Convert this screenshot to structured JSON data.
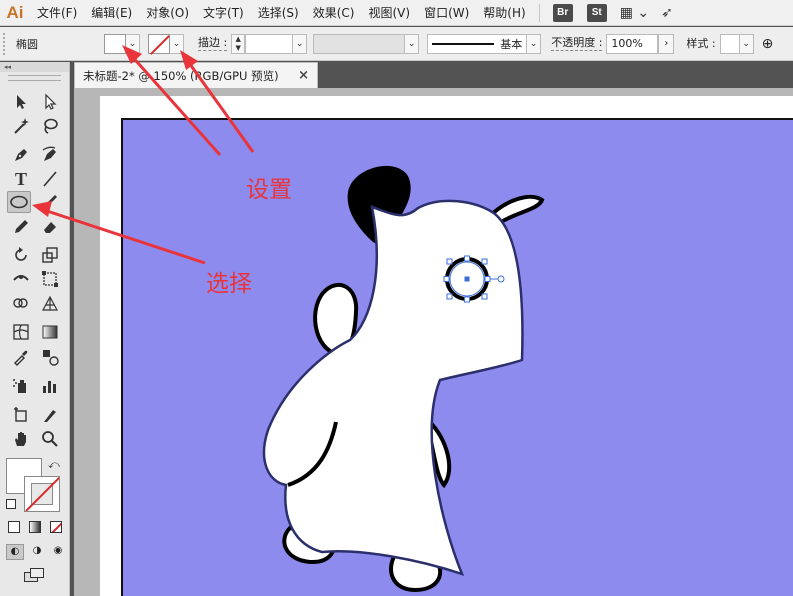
{
  "app": {
    "logo": "Ai"
  },
  "menu": [
    "文件(F)",
    "编辑(E)",
    "对象(O)",
    "文字(T)",
    "选择(S)",
    "效果(C)",
    "视图(V)",
    "窗口(W)",
    "帮助(H)"
  ],
  "bridge_badges": [
    "Br",
    "St"
  ],
  "control": {
    "tool_name": "椭圆",
    "stroke_label": "描边 :",
    "stroke_style": "基本",
    "opacity_label": "不透明度 :",
    "opacity_value": "100%",
    "style_label": "样式 :"
  },
  "toolbox": {
    "header": "◂◂"
  },
  "document": {
    "tab_title": "未标题-2* @ 150% (RGB/GPU 预览)",
    "close": "×"
  },
  "annotations": {
    "set": "设置",
    "select": "选择"
  },
  "colors": {
    "canvas": "#8e8bef",
    "arrow": "#e8343a",
    "accent": "#c8742a"
  }
}
